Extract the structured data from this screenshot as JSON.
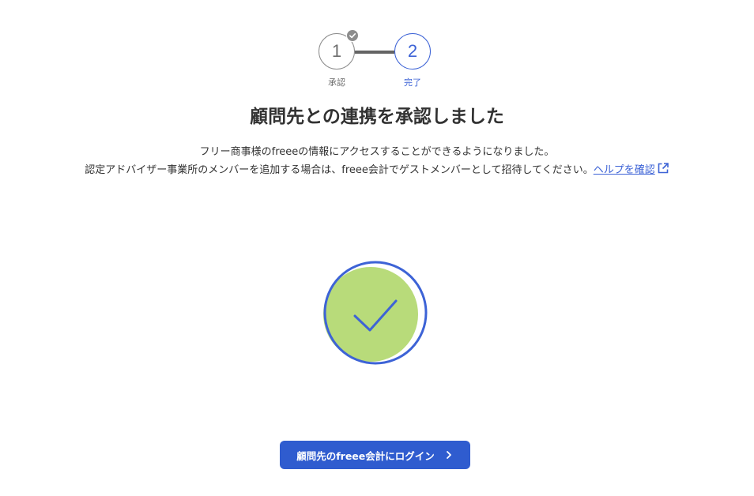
{
  "stepper": {
    "steps": [
      {
        "number": "1",
        "label": "承認",
        "status": "completed"
      },
      {
        "number": "2",
        "label": "完了",
        "status": "current"
      }
    ]
  },
  "title": "顧問先との連携を承認しました",
  "description": {
    "line1": "フリー商事様のfreeeの情報にアクセスすることができるようになりました。",
    "line2": "認定アドバイザー事業所のメンバーを追加する場合は、freee会計でゲストメンバーとして招待してください。",
    "help_link": "ヘルプを確認"
  },
  "illustration": {
    "icon": "success-checkmark-icon",
    "fill_color": "#b8db7a",
    "stroke_color": "#3d63d6"
  },
  "login_button": {
    "label": "顧問先のfreee会計にログイン",
    "icon": "chevron-right-icon"
  },
  "colors": {
    "accent": "#3d63d6",
    "button": "#2f5ccf",
    "text": "#323232",
    "muted": "#6e6e6e"
  }
}
